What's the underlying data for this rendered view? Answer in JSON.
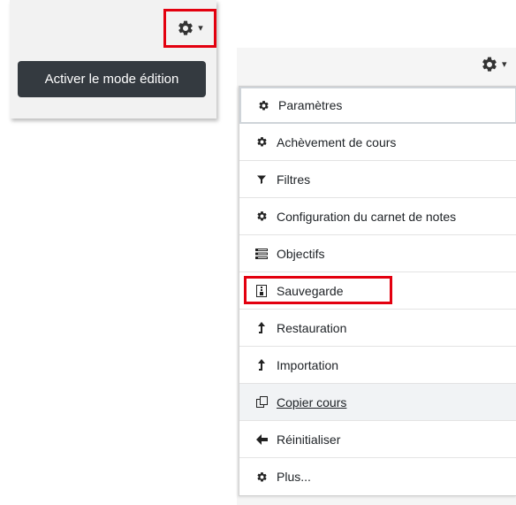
{
  "left_panel": {
    "gear_icon": "gear-icon",
    "caret_icon": "caret-down-icon",
    "edit_button_label": "Activer le mode édition"
  },
  "right_panel": {
    "gear_icon": "gear-icon",
    "caret_icon": "caret-down-icon",
    "menu_items": [
      {
        "label": "Paramètres",
        "icon": "gear-icon"
      },
      {
        "label": "Achèvement de cours",
        "icon": "gear-icon"
      },
      {
        "label": "Filtres",
        "icon": "filter-icon"
      },
      {
        "label": "Configuration du carnet de notes",
        "icon": "gear-icon"
      },
      {
        "label": "Objectifs",
        "icon": "list-icon"
      },
      {
        "label": "Sauvegarde",
        "icon": "file-archive-icon"
      },
      {
        "label": "Restauration",
        "icon": "level-up-icon"
      },
      {
        "label": "Importation",
        "icon": "level-up-icon"
      },
      {
        "label": "Copier cours",
        "icon": "copy-icon"
      },
      {
        "label": "Réinitialiser",
        "icon": "arrow-left-icon"
      },
      {
        "label": "Plus...",
        "icon": "gear-icon"
      }
    ]
  },
  "colors": {
    "highlight": "#e3000f",
    "button_dark": "#343a40"
  }
}
